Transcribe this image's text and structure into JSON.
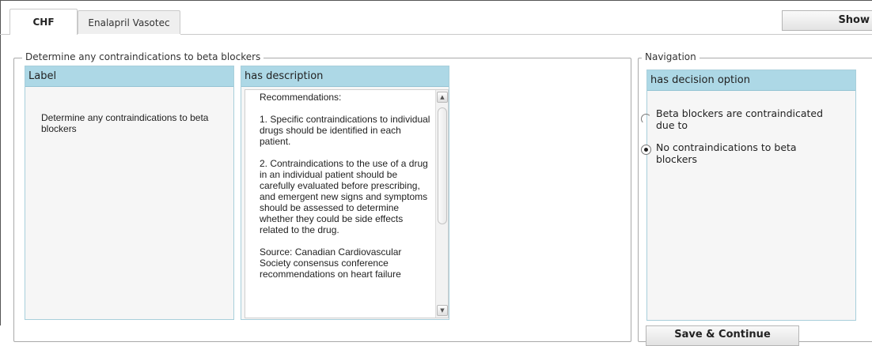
{
  "tabs": [
    {
      "label": "CHF"
    },
    {
      "label": "Enalapril Vasotec"
    }
  ],
  "show_button": "Show",
  "main_section": {
    "legend": "Determine any contraindications to beta blockers",
    "label_panel": {
      "header": "Label",
      "text": "Determine any contraindications to beta blockers"
    },
    "description_panel": {
      "header": "has description",
      "paragraphs": [
        "Recommendations:",
        "1. Specific contraindications to individual drugs should be identified in each patient.",
        "2. Contraindications to the use of a drug in an individual patient should be carefully evaluated before prescribing, and emergent new signs and symptoms should be assessed to determine whether they could be side effects related to the drug.",
        "Source: Canadian Cardiovascular Society consensus conference recommendations on heart failure"
      ]
    }
  },
  "navigation": {
    "legend": "Navigation",
    "header": "has decision option",
    "options": [
      {
        "label": "Beta blockers are contraindicated due to",
        "selected": false
      },
      {
        "label": "No contraindications to beta blockers",
        "selected": true
      }
    ],
    "save_button": "Save & Continue"
  }
}
